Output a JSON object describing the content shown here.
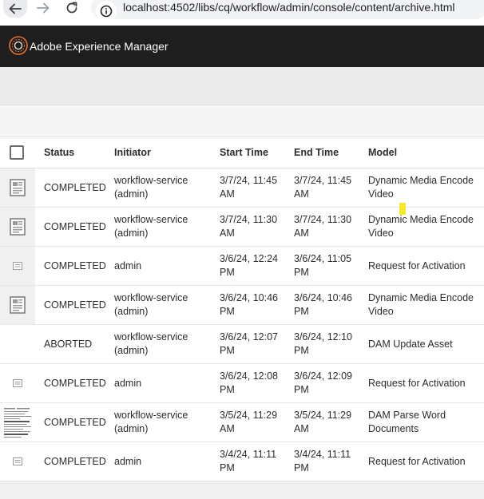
{
  "browser": {
    "url": "localhost:4502/libs/cq/workflow/admin/console/content/archive.html"
  },
  "app": {
    "title": "Adobe Experience Manager"
  },
  "table": {
    "headers": {
      "status": "Status",
      "initiator": "Initiator",
      "start_time": "Start Time",
      "end_time": "End Time",
      "model": "Model"
    },
    "rows": [
      {
        "thumb": "document",
        "status": "COMPLETED",
        "initiator": "workflow-service (admin)",
        "start": "3/7/24, 11:45 AM",
        "end": "3/7/24, 11:45 AM",
        "model": "Dynamic Media Encode Video"
      },
      {
        "thumb": "document",
        "status": "COMPLETED",
        "initiator": "workflow-service (admin)",
        "start": "3/7/24, 11:30 AM",
        "end": "3/7/24, 11:30 AM",
        "model": "Dynamic Media Encode Video"
      },
      {
        "thumb": "page",
        "status": "COMPLETED",
        "initiator": "admin",
        "start": "3/6/24, 12:24 PM",
        "end": "3/6/24, 11:05 PM",
        "model": "Request for Activation"
      },
      {
        "thumb": "document",
        "status": "COMPLETED",
        "initiator": "workflow-service (admin)",
        "start": "3/6/24, 10:46 PM",
        "end": "3/6/24, 10:46 PM",
        "model": "Dynamic Media Encode Video"
      },
      {
        "thumb": "none",
        "status": "ABORTED",
        "initiator": "workflow-service (admin)",
        "start": "3/6/24, 12:07 PM",
        "end": "3/6/24, 12:10 PM",
        "model": "DAM Update Asset"
      },
      {
        "thumb": "page",
        "status": "COMPLETED",
        "initiator": "admin",
        "start": "3/6/24, 12:08 PM",
        "end": "3/6/24, 12:09 PM",
        "model": "Request for Activation"
      },
      {
        "thumb": "scan",
        "status": "COMPLETED",
        "initiator": "workflow-service (admin)",
        "start": "3/5/24, 11:29 AM",
        "end": "3/5/24, 11:29 AM",
        "model": "DAM Parse Word Documents"
      },
      {
        "thumb": "page",
        "status": "COMPLETED",
        "initiator": "admin",
        "start": "3/4/24, 11:11 PM",
        "end": "3/4/24, 11:11 PM",
        "model": "Request for Activation"
      }
    ]
  },
  "icons": {
    "back": "back-arrow-icon",
    "forward": "forward-arrow-icon",
    "reload": "reload-icon",
    "info": "info-icon",
    "logo": "aem-logo-icon"
  },
  "colors": {
    "header_bg": "#1e1e1e",
    "logo_accent": "#e8702a",
    "action_bar_bg": "#eaeaea"
  }
}
